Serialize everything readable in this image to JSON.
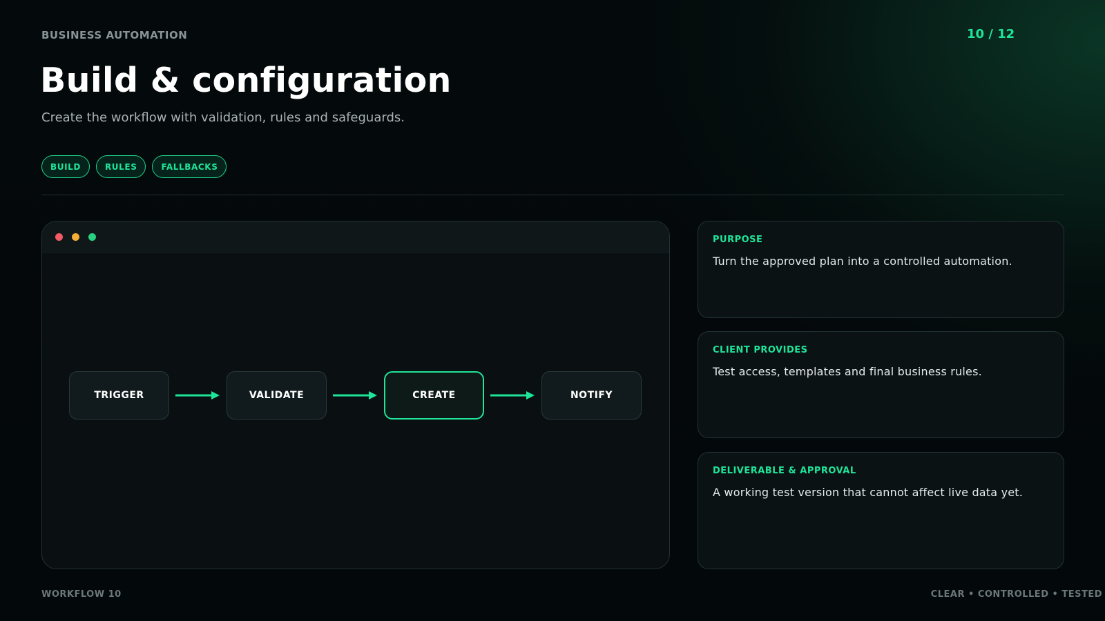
{
  "header": {
    "eyebrow": "BUSINESS AUTOMATION",
    "counter": "10 / 12",
    "title": "Build & configuration",
    "subtitle": "Create the workflow with validation, rules and safeguards."
  },
  "tags": [
    "BUILD",
    "RULES",
    "FALLBACKS"
  ],
  "window": {
    "controls": [
      "close-dot",
      "minimize-dot",
      "maximize-dot"
    ],
    "flow": {
      "steps": [
        "TRIGGER",
        "VALIDATE",
        "CREATE",
        "NOTIFY"
      ],
      "active_step": "CREATE"
    }
  },
  "cards": [
    {
      "label": "PURPOSE",
      "text": "Turn the approved plan into a controlled automation."
    },
    {
      "label": "CLIENT PROVIDES",
      "text": "Test access, templates and final business rules."
    },
    {
      "label": "DELIVERABLE & APPROVAL",
      "text": "A working test version that cannot affect live data yet."
    }
  ],
  "footer": {
    "left": "WORKFLOW 10",
    "right": "CLEAR • CONTROLLED • TESTED"
  },
  "colors": {
    "accent": "#1fe59a",
    "background": "#03080a",
    "panel": "#0a1012",
    "dot_red": "#f25a64",
    "dot_yellow": "#f4ae36",
    "dot_green": "#28d17f"
  }
}
